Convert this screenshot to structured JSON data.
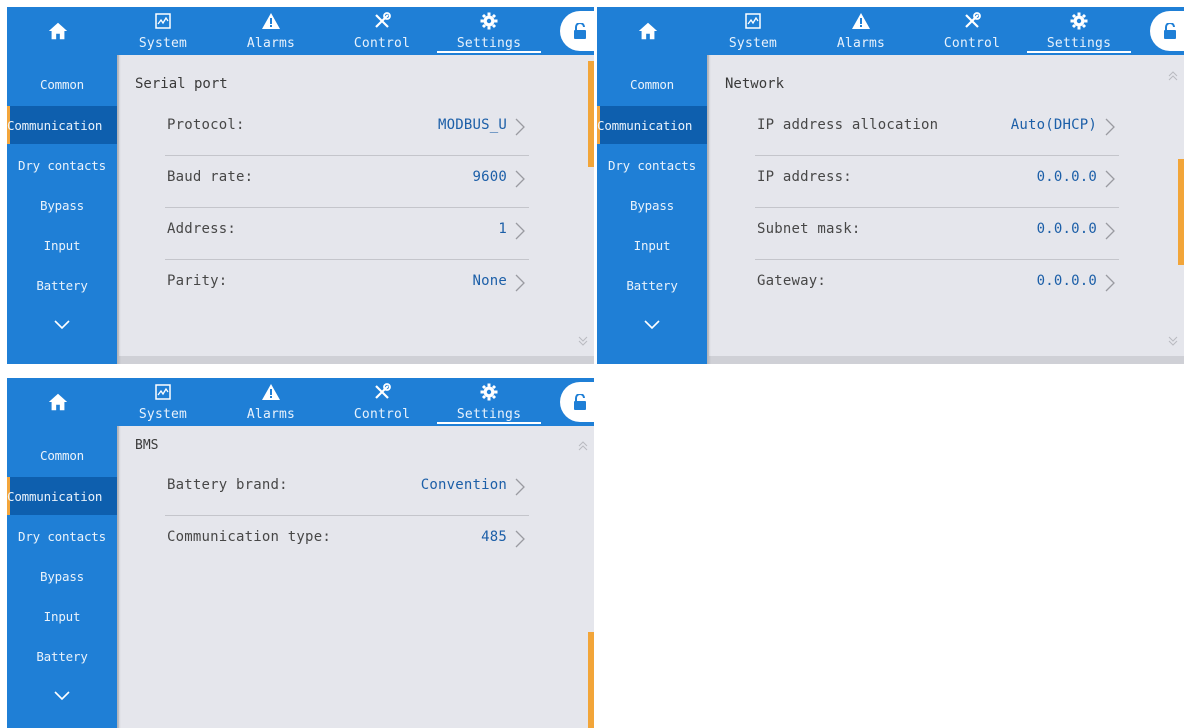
{
  "nav": {
    "tabs": [
      {
        "label": "System",
        "icon": "chart-monitor-icon"
      },
      {
        "label": "Alarms",
        "icon": "warning-triangle-icon"
      },
      {
        "label": "Control",
        "icon": "tools-icon"
      },
      {
        "label": "Settings",
        "icon": "gear-icon"
      }
    ],
    "active_tab": "Settings",
    "home_icon": "home-icon",
    "lock_icon": "unlocked-padlock-icon"
  },
  "sidebar": {
    "items": [
      "Common",
      "Communication",
      "Dry contacts",
      "Bypass",
      "Input",
      "Battery"
    ],
    "active": "Communication",
    "more_icon": "chevron-down-icon"
  },
  "colors": {
    "nav_blue": "#1f7fd6",
    "active_sidebar": "#0e5fae",
    "accent_orange": "#f2a539",
    "value_blue": "#1c5fa8",
    "panel_bg": "#e5e6ec"
  },
  "screens": [
    {
      "section_title": "Serial port",
      "rows": [
        {
          "label": "Protocol:",
          "value": "MODBUS_U"
        },
        {
          "label": "Baud rate:",
          "value": "9600"
        },
        {
          "label": "Address:",
          "value": "1"
        },
        {
          "label": "Parity:",
          "value": "None"
        }
      ]
    },
    {
      "section_title": "Network",
      "rows": [
        {
          "label": "IP address allocation",
          "value": "Auto(DHCP)"
        },
        {
          "label": "IP address:",
          "value": "0.0.0.0"
        },
        {
          "label": "Subnet mask:",
          "value": "0.0.0.0"
        },
        {
          "label": "Gateway:",
          "value": "0.0.0.0"
        }
      ]
    },
    {
      "section_title": "BMS",
      "rows": [
        {
          "label": "Battery brand:",
          "value": "Convention"
        },
        {
          "label": "Communication type:",
          "value": "485"
        }
      ]
    }
  ]
}
